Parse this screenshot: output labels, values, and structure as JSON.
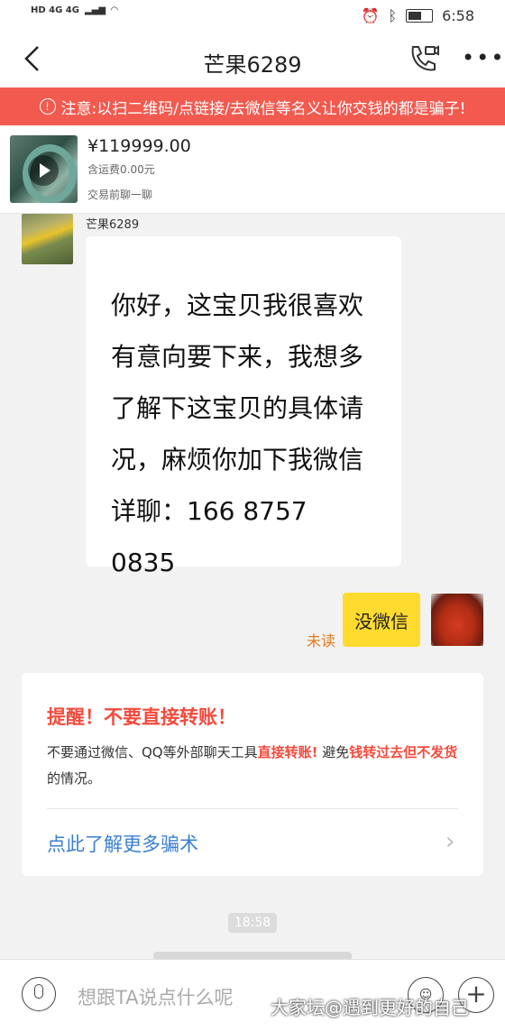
{
  "status_bar": {
    "left_label": "HD 4G 4G",
    "time": "6:58"
  },
  "header": {
    "title": "芒果6289",
    "back_icon": "chevron-left-icon",
    "call_icon": "phone-video-icon",
    "more_icon": "more-dots-icon",
    "more_symbol": "•••",
    "back_symbol": "<"
  },
  "warning": {
    "icon": "!",
    "text": "注意:以扫二维码/点链接/去微信等名义让你交钱的都是骗子!"
  },
  "product": {
    "price": "¥119999.00",
    "shipping": "含运费0.00元",
    "note": "交易前聊一聊"
  },
  "incoming": {
    "sender": "芒果6289",
    "message": "你好，这宝贝我很喜欢有意向要下来，我想多了解下这宝贝的具体请况，麻烦你加下我微信详聊：166 8757 0835"
  },
  "outgoing": {
    "status": "未读",
    "message": "没微信"
  },
  "reminder": {
    "title": "提醒！不要直接转账！",
    "body_part1": "不要通过微信、QQ等外部聊天工具",
    "body_red1": "直接转账!",
    "body_part2": " 避免",
    "body_red2": "钱转过去但不发货",
    "body_part3": "的情况。",
    "link": "点此了解更多骗术",
    "chevron": "›"
  },
  "timestamp": "18:58",
  "input": {
    "placeholder": "想跟TA说点什么呢",
    "plus_symbol": "+",
    "emoji_symbol": "☺"
  },
  "watermark": "大家坛@遇到更好的自己"
}
